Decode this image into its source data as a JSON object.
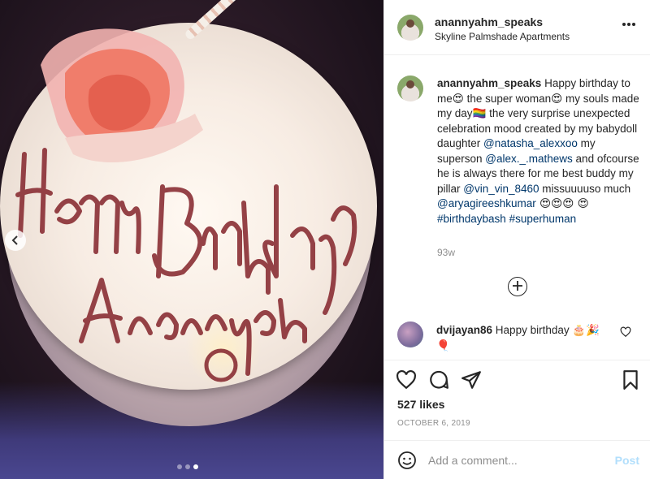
{
  "post": {
    "username": "anannyahm_speaks",
    "location": "Skyline Palmshade Apartments",
    "more_icon": "more-horizontal-icon"
  },
  "photo": {
    "cake_text_line1": "Happy Birthday",
    "cake_text_line2": "Anannyah",
    "carousel_count": 3,
    "carousel_active": 3
  },
  "caption": {
    "username": "anannyahm_speaks",
    "seg1": " Happy birthday to me",
    "emoji1": "😍",
    "seg2": " the super woman",
    "emoji2": "😍",
    "seg3": " my souls made my day",
    "emoji3": "🏳️‍🌈",
    "seg4": " the very surprise unexpected celebration mood created by my babydoll daughter ",
    "mention1": "@natasha_alexxoo",
    "seg5": " my superson ",
    "mention2": "@alex._.mathews",
    "seg6": " and ofcourse he is always there for me best buddy my pillar ",
    "mention3": "@vin_vin_8460",
    "seg7": " missuuuuso much ",
    "mention4": "@aryagireeshkumar",
    "emoji4": " 😍😍😍 😍 ",
    "hashtag1": "#birthdaybash",
    "hashtag2": "#superhuman",
    "time": "93w"
  },
  "comment": {
    "username": "dvijayan86",
    "text": " Happy birthday ",
    "emoji": "🎂🎉🎈"
  },
  "actions": {
    "likes": "527 likes",
    "date": "OCTOBER 6, 2019"
  },
  "add_comment": {
    "placeholder": "Add a comment...",
    "post_label": "Post"
  }
}
